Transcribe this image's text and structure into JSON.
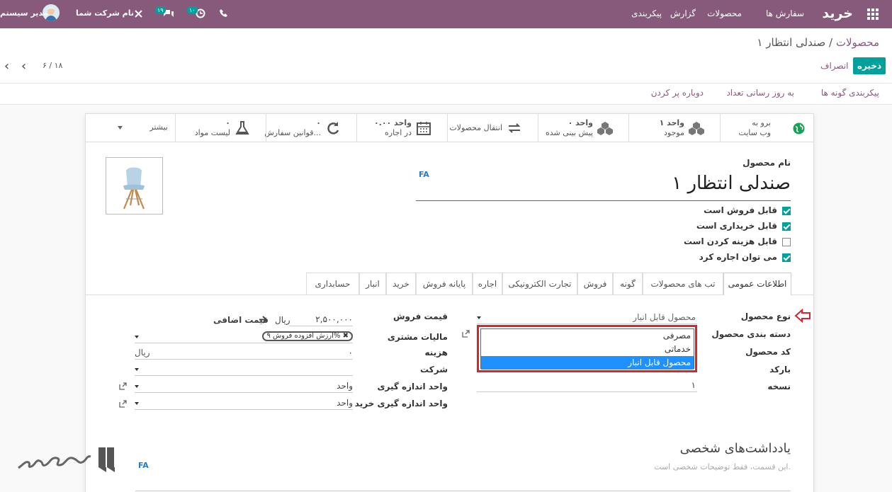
{
  "topbar": {
    "app_title": "خرید",
    "menu": [
      "سفارش ها",
      "محصولات",
      "گزارش",
      "پیکربندی"
    ],
    "user_name": "مدیر سیستم",
    "company_name": "نام شرکت شما",
    "messages_count": "۱۹",
    "activities_count": "۱۰",
    "icons": [
      "apps-icon",
      "phone-icon",
      "clock-icon",
      "chat-icon",
      "tools-icon"
    ],
    "bg_color": "#875a7b"
  },
  "breadcrumb": {
    "parent": "محصولات",
    "separator": "/",
    "current": "صندلی انتظار ۱"
  },
  "actions": {
    "save": "ذخیره",
    "discard": "انصراف"
  },
  "pager": {
    "text": "۶ / ۱۸"
  },
  "status_actions": [
    "پیکربندی گونه ها",
    "به روز رسانی تعداد",
    "دوباره پر کردن"
  ],
  "smart_buttons": [
    {
      "line1": "برو به",
      "line2": "وب سایت",
      "icon": "globe-icon"
    },
    {
      "line1": "۱ واحد",
      "line2": "موجود",
      "icon": "cubes-icon"
    },
    {
      "line1": "۰ واحد",
      "line2": "پیش بینی شده",
      "icon": "cubes-icon"
    },
    {
      "line1": "",
      "line2": "انتقال محصولات",
      "icon": "exchange-icon"
    },
    {
      "line1": "۰.۰۰ واحد",
      "line2": "در اجاره",
      "icon": "calendar-icon"
    },
    {
      "line1": "۰",
      "line2": "قوانین سفارش...",
      "icon": "refresh-icon"
    },
    {
      "line1": "۰",
      "line2": "لیست مواد",
      "icon": "flask-icon"
    },
    {
      "line1": "",
      "line2": "بیشتر",
      "icon": "caret-down-icon"
    }
  ],
  "product": {
    "name_label": "نام محصول",
    "name": "صندلی انتظار ۱",
    "lang_tag": "FA",
    "flags": [
      {
        "label": "قابل فروش است",
        "checked": true
      },
      {
        "label": "قابل خریداری است",
        "checked": true
      },
      {
        "label": "قابل هزینه کردن است",
        "checked": false
      },
      {
        "label": "می توان اجاره کرد",
        "checked": true
      }
    ]
  },
  "tabs": [
    "اطلاعات عمومی",
    "تب های محصولات",
    "گونه",
    "فروش",
    "تجارت الکترونیکی",
    "اجاره",
    "پایانه فروش",
    "خرید",
    "انبار",
    "حسابداری"
  ],
  "general": {
    "labels": {
      "product_type": "نوع محصول",
      "category": "دسته بندی محصول",
      "code": "کد محصول",
      "barcode": "بارکد",
      "version": "نسخه",
      "sale_price": "قیمت فروش",
      "customer_tax": "مالیات مشتری",
      "cost": "هزینه",
      "company": "شرکت",
      "uom": "واحد اندازه گیری",
      "purchase_uom": "واحد اندازه گیری خرید"
    },
    "values": {
      "product_type": "محصول قابل انبار",
      "version": "۱",
      "sale_price": "۲,۵۰۰,۰۰۰",
      "sale_currency": "ریال",
      "extra_price": "قیمت اضافی",
      "tax_tag": "ارزش افزوده فروش ۹%",
      "cost": "۰",
      "cost_currency": "ریال",
      "uom": "واحد",
      "purchase_uom": "واحد"
    },
    "type_options": [
      "مصرفی",
      "خدماتی",
      "محصول قابل انبار"
    ]
  },
  "notes": {
    "title": "یادداشت‌های شخصی",
    "placeholder": "این قسمت، فقط توضیحات شخصی است.",
    "lang_tag": "FA"
  },
  "colors": {
    "accent": "#875a7b",
    "primary": "#00a09d",
    "highlight": "#d9242c",
    "selection": "#1e90ff"
  }
}
